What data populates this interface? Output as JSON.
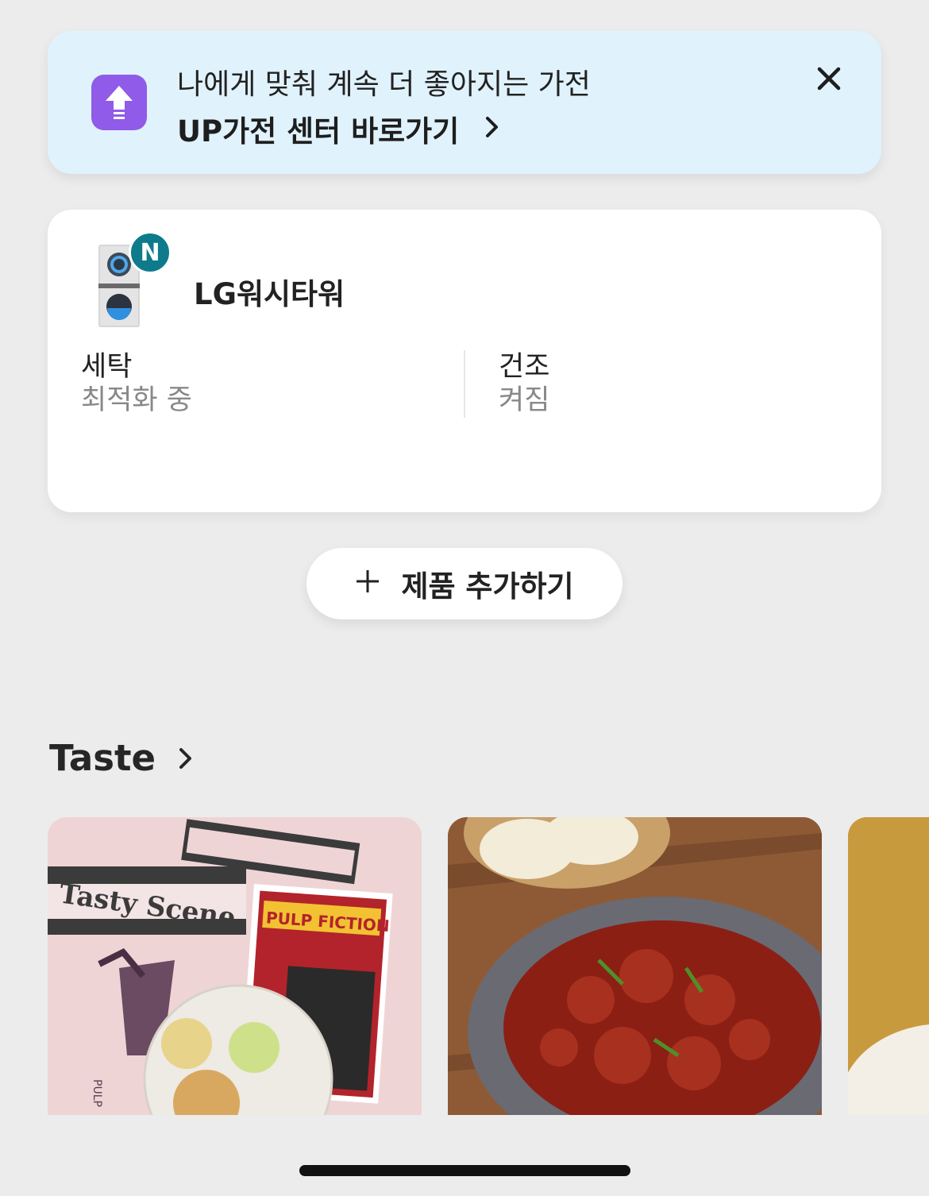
{
  "banner": {
    "subtitle": "나에게 맞춰 계속 더 좋아지는 가전",
    "title": "UP가전 센터 바로가기",
    "icon": "upload-arrow-icon",
    "accent_color": "#8f5be8",
    "background_color": "#e0f2fc"
  },
  "device": {
    "name": "LG워시타워",
    "badge": "N",
    "badge_color": "#0e7b8c",
    "wash": {
      "label": "세탁",
      "value": "최적화 중"
    },
    "dry": {
      "label": "건조",
      "value": "켜짐"
    }
  },
  "add_product": {
    "label": "제품 추가하기"
  },
  "taste": {
    "title": "Taste",
    "cards": [
      {
        "name": "tasty-scene-card",
        "heading": "Tasty Scene",
        "poster_title": "PULP FICTION",
        "side_text": "PULP"
      },
      {
        "name": "spicy-octopus-card"
      },
      {
        "name": "partial-card"
      }
    ]
  }
}
